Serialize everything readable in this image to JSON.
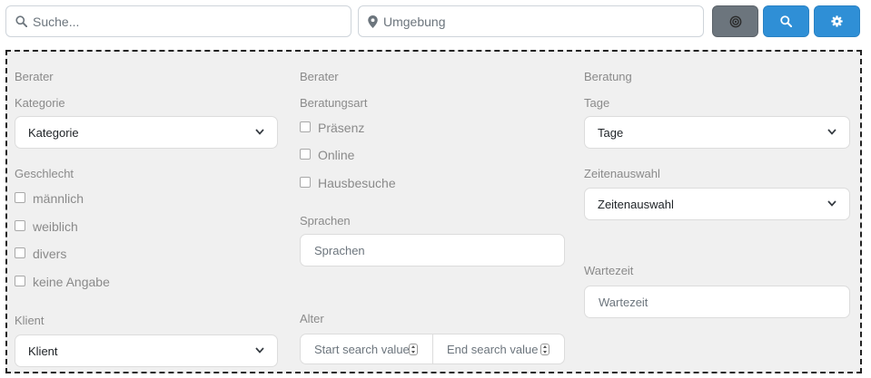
{
  "topbar": {
    "search_placeholder": "Suche...",
    "environment_placeholder": "Umgebung"
  },
  "colors": {
    "primary": "#2f8fd6",
    "secondary": "#6c757d",
    "panel_background": "#f0f0f0"
  },
  "icons": {
    "search_field": "search-icon",
    "environment_field": "map-pin-icon",
    "locate_button": "target-icon",
    "search_button": "search-icon",
    "settings_button": "gear-icon",
    "dropdown": "chevron-down-icon"
  },
  "filters": {
    "col1": {
      "section": "Berater",
      "kategorie": {
        "label": "Kategorie",
        "value": "Kategorie"
      },
      "geschlecht": {
        "label": "Geschlecht",
        "options": [
          "männlich",
          "weiblich",
          "divers",
          "keine Angabe"
        ]
      },
      "klient_section": "Klient",
      "klient_select": "Klient"
    },
    "col2": {
      "section": "Berater",
      "beratungsart": {
        "label": "Beratungsart",
        "options": [
          "Präsenz",
          "Online",
          "Hausbesuche"
        ]
      },
      "sprachen": {
        "label": "Sprachen",
        "placeholder": "Sprachen"
      },
      "alter": {
        "label": "Alter",
        "start_placeholder": "Start search value",
        "end_placeholder": "End search value"
      }
    },
    "col3": {
      "section": "Beratung",
      "tage": {
        "label": "Tage",
        "value": "Tage"
      },
      "zeitenauswahl": {
        "label": "Zeitenauswahl",
        "value": "Zeitenauswahl"
      },
      "wartezeit": {
        "label": "Wartezeit",
        "placeholder": "Wartezeit"
      }
    }
  }
}
